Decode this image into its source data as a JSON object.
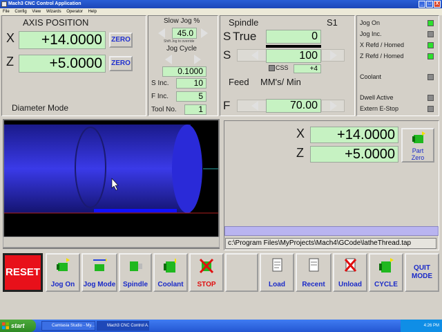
{
  "window": {
    "title": "Mach3 CNC Control Application",
    "minimize": "_",
    "maximize": "□",
    "close": "X"
  },
  "menu": [
    "File",
    "Config",
    "View",
    "Wizards",
    "Operator",
    "Help"
  ],
  "axis": {
    "title": "AXIS POSITION",
    "x_label": "X",
    "x_value": "+14.0000",
    "z_label": "Z",
    "z_value": "+5.0000",
    "zero_label": "ZERO",
    "mode": "Diameter Mode"
  },
  "jog": {
    "slow_jog_label": "Slow Jog %",
    "slow_jog_value": "45.0",
    "shift_hint": "Shift Jog to override",
    "cycle_label": "Jog Cycle",
    "cycle_value": "0.1000",
    "s_inc_label": "S Inc.",
    "s_inc_value": "10",
    "f_inc_label": "F Inc.",
    "f_inc_value": "5",
    "tool_label": "Tool No.",
    "tool_value": "1"
  },
  "spindle": {
    "title": "Spindle",
    "s1": "S1",
    "s_true_label": "S",
    "true_label": "True",
    "true_value": "0",
    "s_label": "S",
    "s_value": "100",
    "css_label": "CSS",
    "css_value": "+4",
    "feed_label": "Feed",
    "feed_units": "MM's/ Min",
    "f_label": "F",
    "f_value": "70.00"
  },
  "status": [
    {
      "label": "Jog On",
      "state": "on"
    },
    {
      "label": "Jog Inc.",
      "state": "off"
    },
    {
      "label": "X Refd / Homed",
      "state": "on"
    },
    {
      "label": "Z Refd / Homed",
      "state": "on"
    },
    {
      "label": "Coolant",
      "state": "off"
    },
    {
      "label": "Dwell Active",
      "state": "off"
    },
    {
      "label": "Extern E-Stop",
      "state": "off"
    }
  ],
  "dro2": {
    "x_label": "X",
    "x_value": "+14.0000",
    "z_label": "Z",
    "z_value": "+5.0000",
    "part_zero_line1": "Part",
    "part_zero_line2": "Zero"
  },
  "file_path": "c:\\Program Files\\MyProjects\\Mach4\\GCode\\latheThread.tap",
  "toolbar": {
    "reset": "RESET",
    "jog_on": "Jog On",
    "jog_mode": "Jog Mode",
    "spindle": "Spindle",
    "coolant": "Coolant",
    "stop": "STOP",
    "load": "Load",
    "recent": "Recent",
    "unload": "Unload",
    "cycle": "CYCLE",
    "quit_line1": "QUIT",
    "quit_line2": "MODE"
  },
  "taskbar": {
    "start": "start",
    "task1": "Camtasia Studio - My...",
    "task2": "Mach3 CNC Control A...",
    "clock": "4:26 PM"
  },
  "colors": {
    "dro_bg": "#c6f2c2",
    "led_on": "#2de02d",
    "reset_red": "#e8101a",
    "caption_blue": "#1a2ac8",
    "xp_blue": "#2456d2"
  }
}
